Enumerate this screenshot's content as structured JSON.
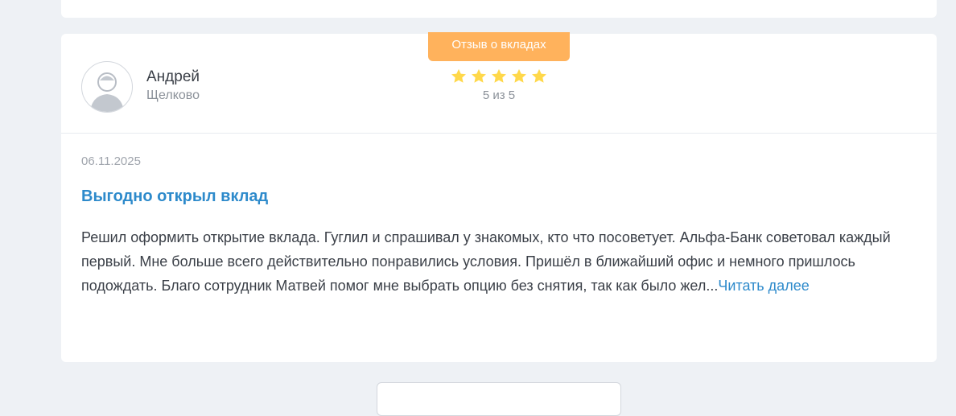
{
  "review": {
    "category": "Отзыв о вкладах",
    "author_name": "Андрей",
    "author_city": "Щелково",
    "rating_value": 5,
    "rating_text": "5 из 5",
    "date": "06.11.2025",
    "title": "Выгодно открыл вклад",
    "text": "Решил оформить открытие вклада. Гуглил и спрашивал у знакомых, кто что посоветует. Альфа-Банк советовал каждый первый. Мне больше всего действительно понравились условия. Пришёл в ближайший офис и немного пришлось подождать. Благо сотрудник Матвей помог мне выбрать опцию без снятия, так как было жел...",
    "read_more": "Читать далее"
  },
  "colors": {
    "accent": "#2d8acb",
    "tag": "#ffb25c",
    "star": "#ffd84a",
    "background": "#eef1f5"
  }
}
